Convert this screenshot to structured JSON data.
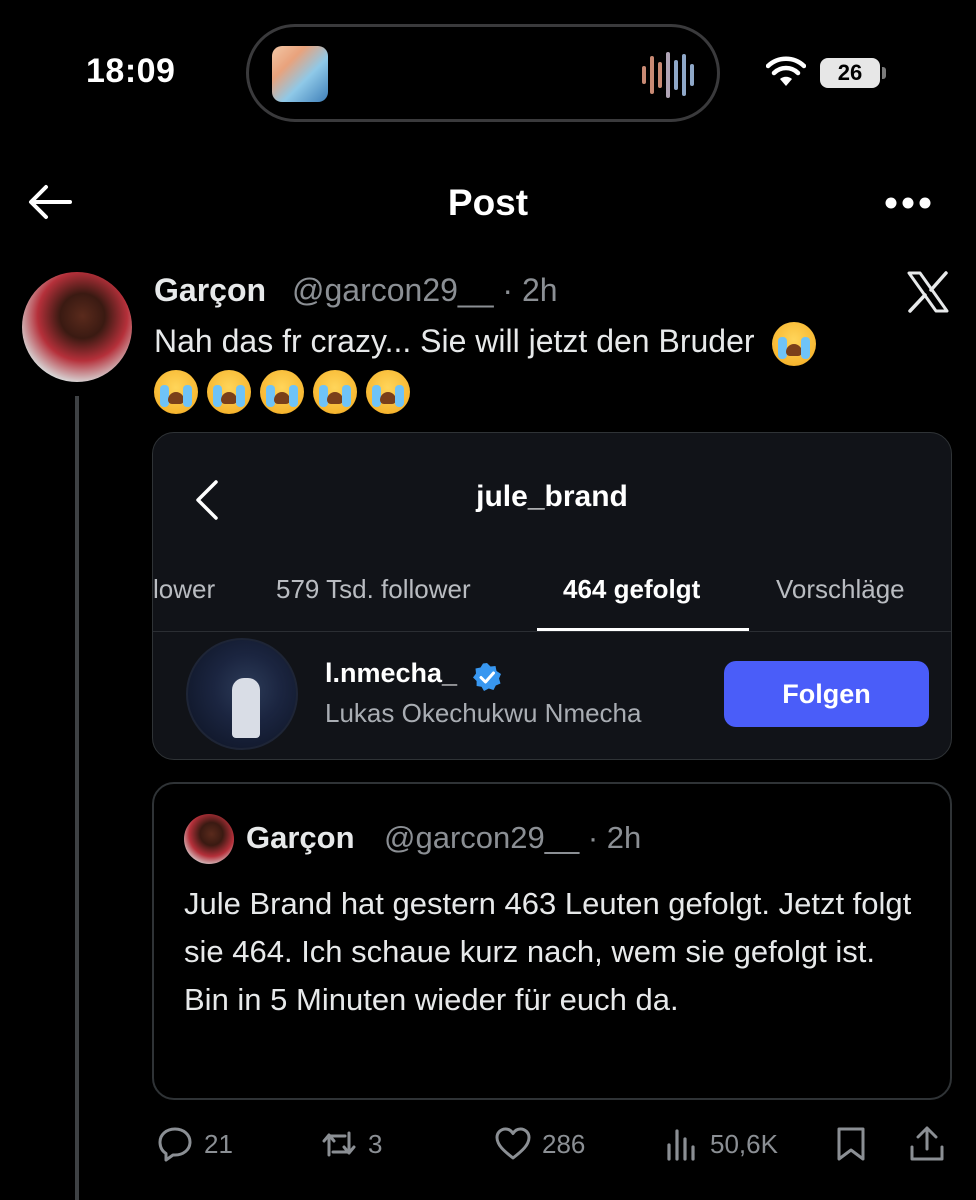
{
  "status_bar": {
    "time": "18:09",
    "battery": "26"
  },
  "nav": {
    "title": "Post"
  },
  "tweet": {
    "name": "Garçon",
    "handle": "@garcon29__ · 2h",
    "text": "Nah das fr crazy... Sie will jetzt den Bruder"
  },
  "card": {
    "title": "jule_brand",
    "tabs": [
      "lower",
      "579 Tsd. follower",
      "464 gefolgt",
      "Vorschläge"
    ],
    "user": {
      "username": "l.nmecha_",
      "full_name": "Lukas Okechukwu Nmecha",
      "button": "Folgen"
    }
  },
  "quote": {
    "name": "Garçon",
    "handle": "@garcon29__ · 2h",
    "text": "Jule Brand hat gestern 463 Leuten gefolgt. Jetzt folgt sie 464. Ich schaue kurz nach, wem sie gefolgt ist. Bin in 5 Minuten wieder für euch da."
  },
  "actions": {
    "replies": "21",
    "reposts": "3",
    "likes": "286",
    "views": "50,6K"
  },
  "icons": [
    "back-arrow-icon",
    "more-icon",
    "x-logo-icon",
    "loudly-crying-emoji",
    "chevron-left-icon",
    "verified-icon",
    "reply-icon",
    "repost-icon",
    "like-icon",
    "views-icon",
    "bookmark-icon",
    "share-icon"
  ],
  "colors": {
    "accent_button": "#4a5df9",
    "verified": "#3897f0",
    "muted_text": "#8b8f94"
  }
}
